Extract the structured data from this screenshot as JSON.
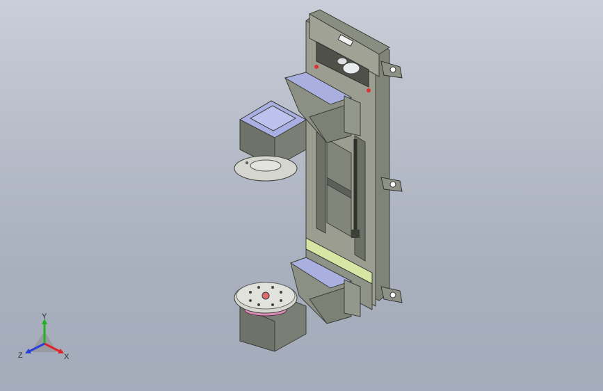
{
  "colors": {
    "background_top": "#c9ced8",
    "background_bottom": "#a4abba",
    "frame_gray": "#8c8f84",
    "frame_dark": "#5b5e55",
    "arm_blue": "#9ea6d8",
    "disc_light": "#d6d6d0",
    "accent_yellow": "#d7e6a4",
    "pink_ring": "#d88fb4",
    "axis_x": "#e0232a",
    "axis_y": "#21b321",
    "axis_z": "#2b3fd9"
  },
  "triad": {
    "x_label": "X",
    "y_label": "Y",
    "z_label": "Z"
  },
  "model": {
    "icon": "cad-robot-arm-assembly"
  }
}
